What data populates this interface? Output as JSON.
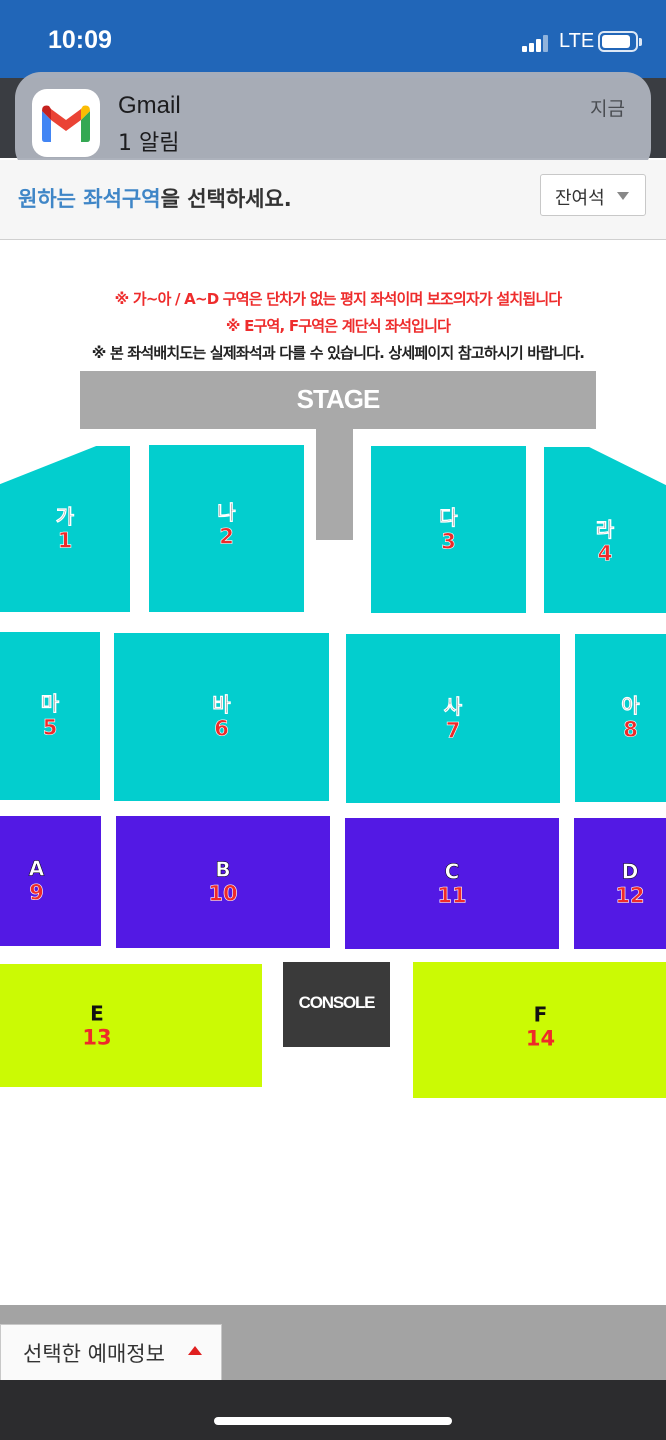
{
  "status_bar": {
    "time": "10:09",
    "network": "LTE",
    "battery_level": 0.9,
    "background": "#2166b8"
  },
  "notification": {
    "app": "Gmail",
    "message": "1 알림",
    "time": "지금"
  },
  "header": {
    "instruction_highlight": "원하는 좌석구역",
    "instruction_rest": "을 선택하세요.",
    "remaining_select": "잔여석"
  },
  "notices": [
    "※ 가~아 / A~D 구역은 단차가 없는 평지 좌석이며 보조의자가 설치됩니다",
    "※ E구역, F구역은 계단식 좌석입니다",
    "※ 본 좌석배치도는 실제좌석과 다를 수 있습니다. 상세페이지 참고하시기 바랍니다."
  ],
  "seat_map": {
    "stage_label": "STAGE",
    "console_label": "CONSOLE",
    "colors": {
      "floor_front": "#03cece",
      "floor_back": "#5319e4",
      "tiered": "#cbfa04",
      "notice_red": "#ee2c2c",
      "number_red": "#ee2a2a"
    },
    "sections": [
      {
        "name": "가",
        "number": "1"
      },
      {
        "name": "나",
        "number": "2"
      },
      {
        "name": "다",
        "number": "3"
      },
      {
        "name": "라",
        "number": "4"
      },
      {
        "name": "마",
        "number": "5"
      },
      {
        "name": "바",
        "number": "6"
      },
      {
        "name": "사",
        "number": "7"
      },
      {
        "name": "아",
        "number": "8"
      },
      {
        "name": "A",
        "number": "9"
      },
      {
        "name": "B",
        "number": "10"
      },
      {
        "name": "C",
        "number": "11"
      },
      {
        "name": "D",
        "number": "12"
      },
      {
        "name": "E",
        "number": "13"
      },
      {
        "name": "F",
        "number": "14"
      }
    ]
  },
  "footer": {
    "booking_info_label": "선택한 예매정보"
  }
}
